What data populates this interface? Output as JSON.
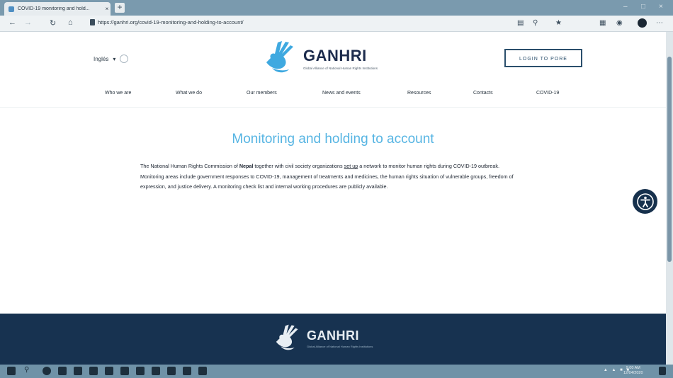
{
  "browser": {
    "tab_title": "COVID-19 monitoring and hold...",
    "tab_close": "×",
    "new_tab": "+",
    "url": "https://ganhri.org/covid-19-monitoring-and-holding-to-account/",
    "window_controls": [
      "–",
      "□",
      "×"
    ]
  },
  "header": {
    "language": "Inglés",
    "logo_name": "GANHRI",
    "logo_tagline": "Global Alliance of National Human Rights Institutions",
    "login_label": "LOGIN TO PORE"
  },
  "nav": {
    "items": [
      "Who we are",
      "What we do",
      "Our members",
      "News and events",
      "Resources",
      "Contacts",
      "COVID-19"
    ]
  },
  "main": {
    "heading": "Monitoring and holding to account",
    "p1": "The National Human Rights Commission of ",
    "p_bold": "Nepal",
    "p2": " together with civil society organizations ",
    "p_link": "set up",
    "p3": " a network to monitor human rights during COVID-19 outbreak. Monitoring areas include government responses to COVID-19, management of treatments and medicines, the human rights situation of vulnerable groups, freedom of expression, and justice delivery. A monitoring check list and internal working procedures are publicly available."
  },
  "footer": {
    "logo_name": "GANHRI",
    "logo_tagline": "Global Alliance of National Human Rights Institutions"
  },
  "taskbar": {
    "time": "9:00 AM",
    "date": "12/04/2020"
  },
  "colors": {
    "accent": "#57b5e3",
    "brand_navy": "#173250",
    "logo_blue": "#3fa9e0"
  }
}
